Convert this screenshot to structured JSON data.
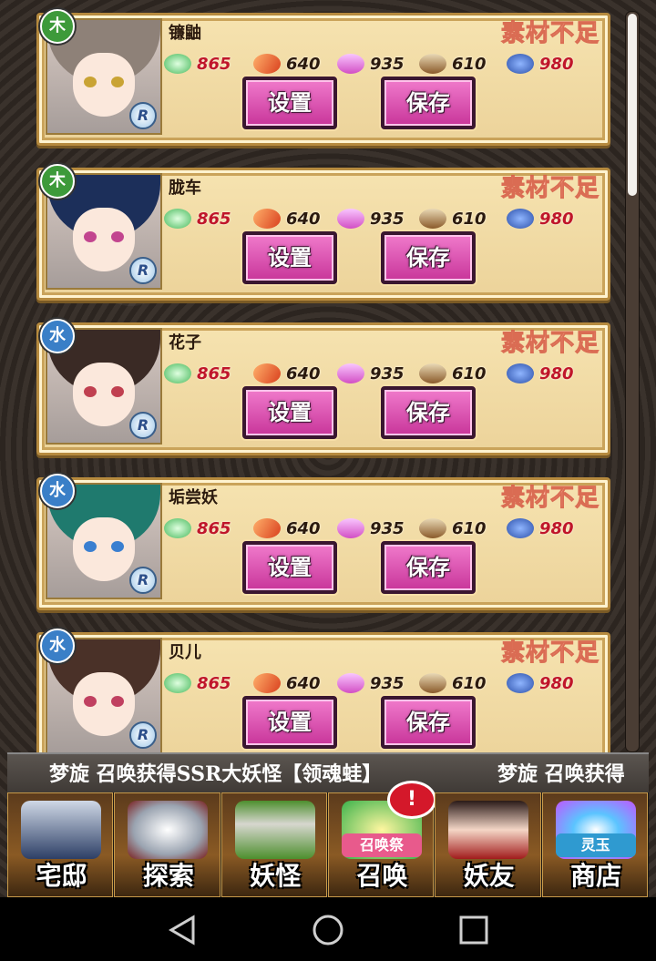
{
  "stamp_label": "素材不足",
  "resources": [
    "865",
    "640",
    "935",
    "610",
    "980"
  ],
  "buttons": {
    "set": "设置",
    "save": "保存"
  },
  "rarity": "R",
  "cards": [
    {
      "name": "镰鼬",
      "element": "木",
      "element_color": "#3d9a3a",
      "hair": "#8e8178",
      "eye": "#c9a334"
    },
    {
      "name": "胧车",
      "element": "木",
      "element_color": "#3d9a3a",
      "hair": "#1c2f5a",
      "eye": "#c2458f"
    },
    {
      "name": "花子",
      "element": "水",
      "element_color": "#3a7fc7",
      "hair": "#3a2a25",
      "eye": "#c04050"
    },
    {
      "name": "垢尝妖",
      "element": "水",
      "element_color": "#3a7fc7",
      "hair": "#1f7a6e",
      "eye": "#3a7fd0"
    },
    {
      "name": "贝儿",
      "element": "水",
      "element_color": "#3a7fc7",
      "hair": "#4a3128",
      "eye": "#c04060"
    }
  ],
  "ticker": {
    "text": "梦旋  召唤获得SSR大妖怪【领魂蛙】",
    "repeat": "梦旋  召唤获得"
  },
  "nav": [
    {
      "label": "宅邸",
      "icon": "house-icon"
    },
    {
      "label": "探索",
      "icon": "magnifier-icon"
    },
    {
      "label": "妖怪",
      "icon": "scroll-icon"
    },
    {
      "label": "召唤",
      "icon": "summon-star-icon",
      "badge": "!",
      "fest": "召唤祭"
    },
    {
      "label": "妖友",
      "icon": "friend-girl-icon"
    },
    {
      "label": "商店",
      "icon": "orb-icon",
      "orb_text": "灵玉"
    }
  ]
}
